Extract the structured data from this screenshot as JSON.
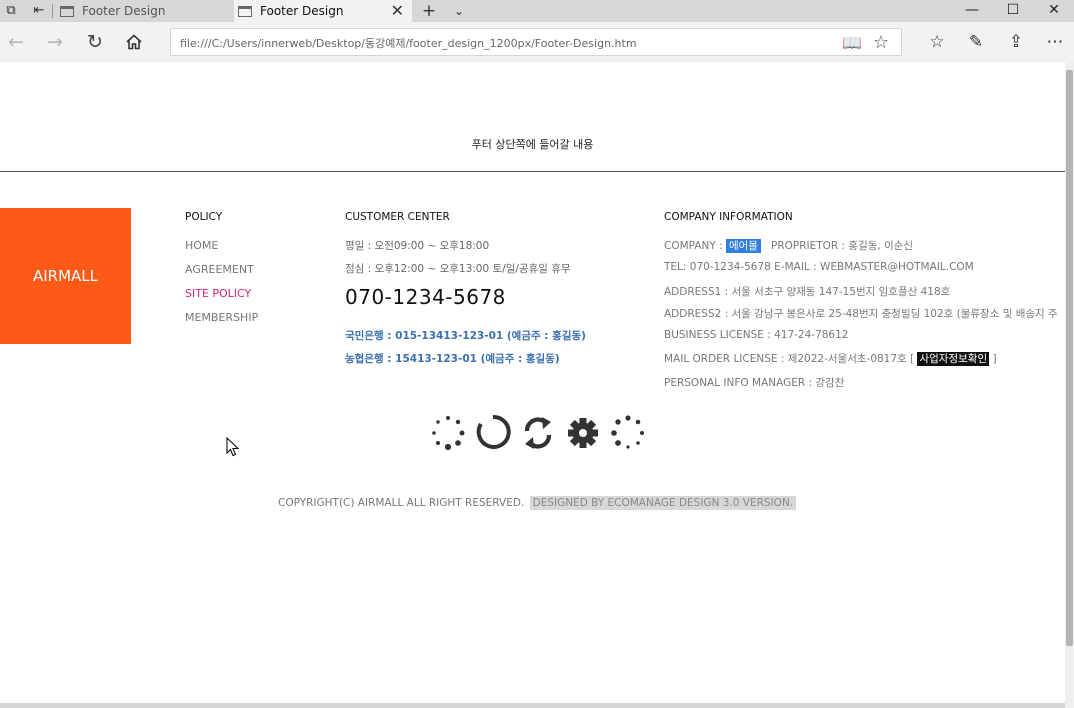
{
  "browser": {
    "tabs": [
      {
        "title": "Footer Design",
        "active": false
      },
      {
        "title": "Footer Design",
        "active": true
      }
    ],
    "new_tab_glyph": "+",
    "url": "file:///C:/Users/innerweb/Desktop/동강예제/footer_design_1200px/Footer-Design.htm"
  },
  "page": {
    "top_note": "푸터 상단쪽에 들어갈 내용",
    "logo": "AIRMALL",
    "policy": {
      "title": "POLICY",
      "links": [
        "HOME",
        "AGREEMENT",
        "SITE POLICY",
        "MEMBERSHIP"
      ],
      "active_index": 2
    },
    "customer_center": {
      "title": "CUSTOMER CENTER",
      "hours_weekday": "평일 : 오전09:00 ~ 오후18:00",
      "hours_lunch": "점심 : 오후12:00 ~ 오후13:00 토/일/공휴일 휴무",
      "phone": "070-1234-5678",
      "bank1": "국민은행 : 015-13413-123-01 (예금주 : 홍길동)",
      "bank2": "농협은행 : 15413-123-01 (예금주 : 홍길동)"
    },
    "company": {
      "title": "COMPANY INFORMATION",
      "company_label": "COMPANY : ",
      "company_name": "에어몰",
      "proprietor": "PROPRIETOR : 홍길동, 이순신",
      "contact": "TEL: 070-1234-5678   E-MAIL : WEBMASTER@HOTMAIL.COM",
      "address1": "ADDRESS1 : 서울 서초구 양재동 147-15번지 임호플산 418호",
      "address2": "ADDRESS2 : 서울 강남구 봉은사로 25-48번지 충청빌딩 102호 (물류장소 및 배송지 주",
      "business_license": "BUSINESS LICENSE : 417-24-78612",
      "mail_order_prefix": "MAIL ORDER LICENSE : 제2022-서울서초-0817호 [ ",
      "mail_order_link": "사업자정보확인",
      "mail_order_suffix": " ]",
      "privacy_manager": "PERSONAL INFO MANAGER : 강감찬"
    },
    "loaders": [
      "dots-spinner-icon",
      "ring-spinner-icon",
      "refresh-arrows-icon",
      "gear-icon",
      "dots-circle-icon"
    ],
    "copyright": "COPYRIGHT(C) AIRMALL ALL RIGHT RESERVED.",
    "designed_by": "DESIGNED BY ECOMANAGE DESIGN 3.0 VERSION."
  },
  "colors": {
    "logo_bg": "#fc5a16",
    "active_link": "#d3247b",
    "bank_text": "#3a6fb0",
    "company_highlight": "#2f7fe0"
  }
}
